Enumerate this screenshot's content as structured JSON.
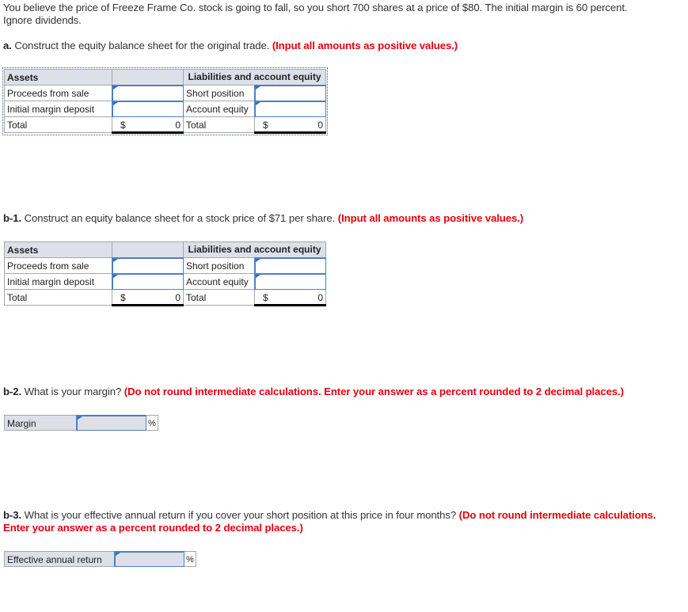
{
  "intro": "You believe the price of Freeze Frame Co. stock is going to fall, so you short 700 shares at a price of $80. The initial margin is 60 percent. Ignore dividends.",
  "part_a": {
    "label": "a.",
    "text": " Construct the equity balance sheet for the original trade. ",
    "instruction": "(Input all amounts as positive values.)",
    "table": {
      "assets_header": "Assets",
      "liab_header": "Liabilities and account equity",
      "rows": [
        {
          "asset_label": "Proceeds from sale",
          "asset_value": "",
          "liab_label": "Short position",
          "liab_value": ""
        },
        {
          "asset_label": "Initial margin deposit",
          "asset_value": "",
          "liab_label": "Account equity",
          "liab_value": ""
        }
      ],
      "total_label": "Total",
      "currency": "$",
      "asset_total": "0",
      "liab_total": "0"
    }
  },
  "part_b1": {
    "label": "b-1.",
    "text": " Construct an equity balance sheet for a stock price of $71 per share. ",
    "instruction": "(Input all amounts as positive values.)",
    "table": {
      "assets_header": "Assets",
      "liab_header": "Liabilities and account equity",
      "rows": [
        {
          "asset_label": "Proceeds from sale",
          "asset_value": "",
          "liab_label": "Short position",
          "liab_value": ""
        },
        {
          "asset_label": "Initial margin deposit",
          "asset_value": "",
          "liab_label": "Account equity",
          "liab_value": ""
        }
      ],
      "total_label": "Total",
      "currency": "$",
      "asset_total": "0",
      "liab_total": "0"
    }
  },
  "part_b2": {
    "label": "b-2.",
    "text": " What is your margin? ",
    "instruction": "(Do not round intermediate calculations. Enter your answer as a percent rounded to 2 decimal places.)",
    "field_label": "Margin",
    "field_value": "",
    "unit": "%"
  },
  "part_b3": {
    "label": "b-3.",
    "text": " What is your effective annual return if you cover your short position at this price in four months? ",
    "instruction": "(Do not round intermediate calculations. Enter your answer as a percent rounded to 2 decimal places.)",
    "field_label": "Effective annual return",
    "field_value": "",
    "unit": "%"
  }
}
